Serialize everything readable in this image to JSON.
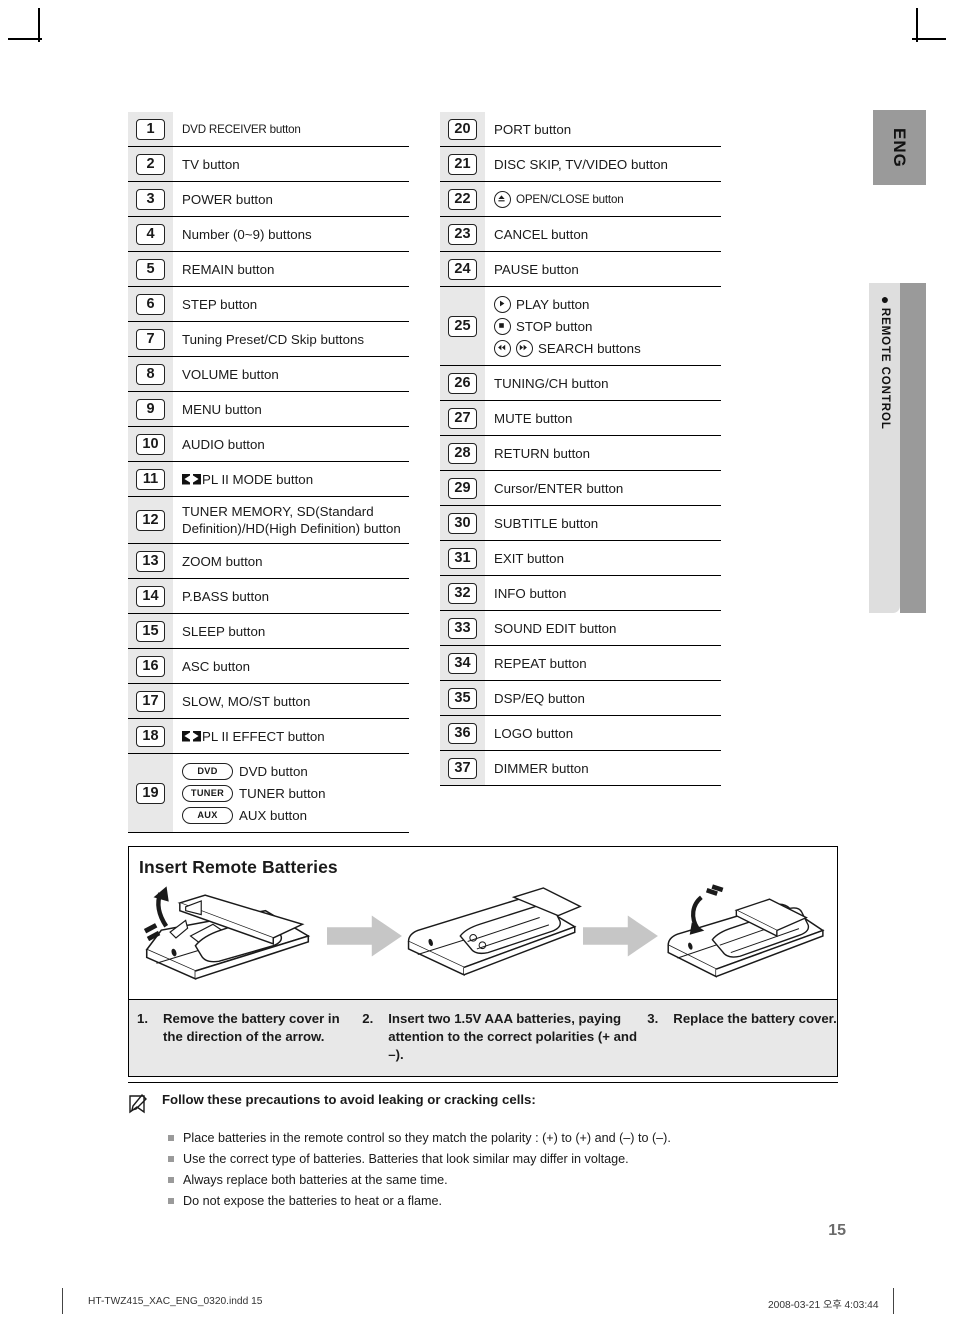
{
  "page": {
    "number": "15",
    "language_tab": "ENG",
    "section_tab": "REMOTE CONTROL",
    "section_tab_dot": "●"
  },
  "legend": {
    "left_items": [
      {
        "num": "1",
        "label": "DVD RECEIVER button",
        "style": "small"
      },
      {
        "num": "2",
        "label": "TV button"
      },
      {
        "num": "3",
        "label": "POWER button"
      },
      {
        "num": "4",
        "label": "Number (0~9) buttons"
      },
      {
        "num": "5",
        "label": "REMAIN button"
      },
      {
        "num": "6",
        "label": "STEP button"
      },
      {
        "num": "7",
        "label": "Tuning Preset/CD Skip buttons"
      },
      {
        "num": "8",
        "label": "VOLUME button"
      },
      {
        "num": "9",
        "label": "MENU button"
      },
      {
        "num": "10",
        "label": "AUDIO button"
      },
      {
        "num": "11",
        "label": "PL II MODE button",
        "icon": "dolby-prologic2-icon"
      },
      {
        "num": "12",
        "label": "TUNER MEMORY, SD(Standard Definition)/HD(High Definition) button"
      },
      {
        "num": "13",
        "label": "ZOOM button"
      },
      {
        "num": "14",
        "label": "P.BASS button"
      },
      {
        "num": "15",
        "label": "SLEEP button"
      },
      {
        "num": "16",
        "label": "ASC button"
      },
      {
        "num": "17",
        "label": "SLOW, MO/ST button"
      },
      {
        "num": "18",
        "label": "PL II EFFECT button",
        "icon": "dolby-prologic2-icon"
      }
    ],
    "item_19": {
      "num": "19",
      "lines": [
        {
          "cap": "DVD",
          "label": "DVD button"
        },
        {
          "cap": "TUNER",
          "label": "TUNER button"
        },
        {
          "cap": "AUX",
          "label": "AUX button"
        }
      ]
    },
    "right_items": [
      {
        "num": "20",
        "label": "PORT button"
      },
      {
        "num": "21",
        "label": "DISC SKIP, TV/VIDEO button"
      },
      {
        "num": "22",
        "label": "OPEN/CLOSE button",
        "icon": "eject-icon",
        "style": "small"
      },
      {
        "num": "23",
        "label": "CANCEL button"
      },
      {
        "num": "24",
        "label": "PAUSE button"
      }
    ],
    "item_25": {
      "num": "25",
      "lines": [
        {
          "icons": [
            "play-icon"
          ],
          "label": "PLAY button"
        },
        {
          "icons": [
            "stop-icon"
          ],
          "label": "STOP button"
        },
        {
          "icons": [
            "rewind-icon",
            "fast-forward-icon"
          ],
          "label": "SEARCH buttons"
        }
      ]
    },
    "right_items_2": [
      {
        "num": "26",
        "label": "TUNING/CH button"
      },
      {
        "num": "27",
        "label": "MUTE button"
      },
      {
        "num": "28",
        "label": "RETURN button"
      },
      {
        "num": "29",
        "label": "Cursor/ENTER button"
      },
      {
        "num": "30",
        "label": "SUBTITLE button"
      },
      {
        "num": "31",
        "label": "EXIT button"
      },
      {
        "num": "32",
        "label": "INFO button"
      },
      {
        "num": "33",
        "label": "SOUND EDIT button"
      },
      {
        "num": "34",
        "label": "REPEAT button"
      },
      {
        "num": "35",
        "label": "DSP/EQ button"
      },
      {
        "num": "36",
        "label": "LOGO button"
      },
      {
        "num": "37",
        "label": "DIMMER button"
      }
    ]
  },
  "battery_section": {
    "title": "Insert Remote Batteries",
    "steps": [
      {
        "n": "1.",
        "text": "Remove the battery cover in the direction of the arrow."
      },
      {
        "n": "2.",
        "text": "Insert two 1.5V AAA batteries, paying attention to the correct polarities (+ and –)."
      },
      {
        "n": "3.",
        "text": "Replace the battery cover."
      }
    ]
  },
  "note": {
    "heading": "Follow these precautions to avoid leaking or cracking cells:",
    "items": [
      "Place batteries in the remote control so they match the polarity : (+) to (+) and (–) to (–).",
      "Use the correct type of batteries. Batteries that look similar may differ in voltage.",
      "Always replace both batteries at the same time.",
      "Do not expose the batteries to heat or a flame."
    ]
  },
  "footer": {
    "filename": "HT-TWZ415_XAC_ENG_0320.indd   15",
    "timestamp": "2008-03-21   오후 4:03:44"
  },
  "colors": {
    "tab_gray": "#9a9a9a",
    "tab_light": "#dedede",
    "num_col": "#e8e8e8",
    "steps_bg": "#e8e8e8",
    "page_no": "#6b6b6b"
  }
}
